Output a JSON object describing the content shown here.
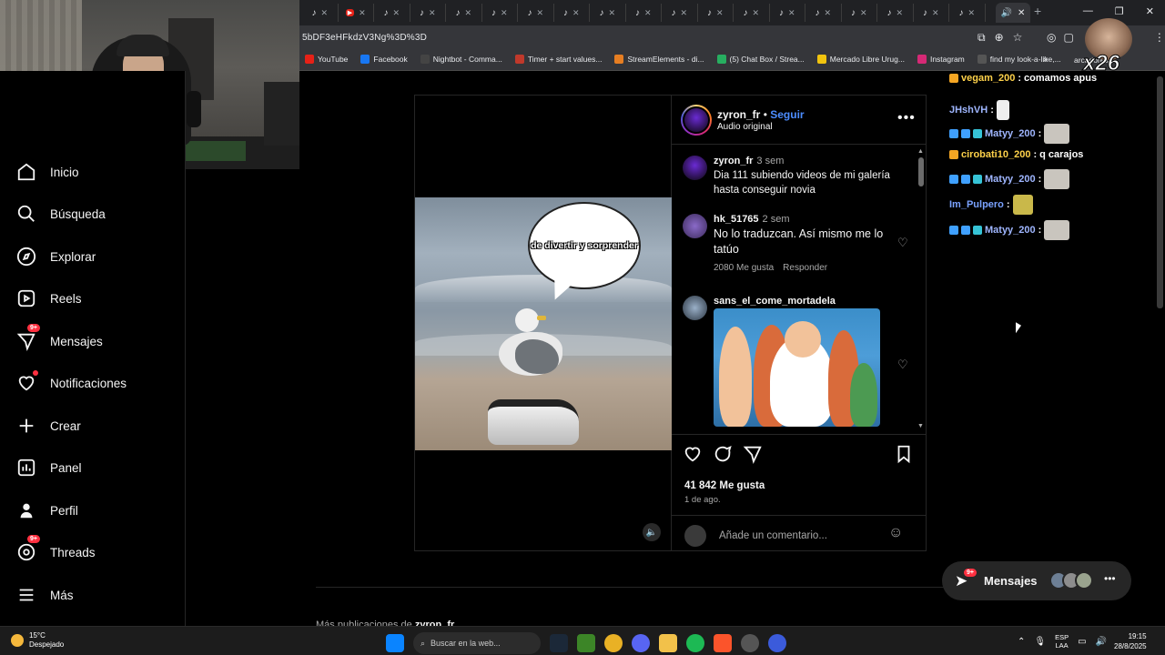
{
  "browser": {
    "url": "5bDF3eHFkdzV3Ng%3D%3D",
    "active_tab_icon": "speaker-icon",
    "tab_count_visible": 19,
    "bookmarks": [
      {
        "label": "YouTube",
        "color": "#e62117"
      },
      {
        "label": "Facebook",
        "color": "#1877f2"
      },
      {
        "label": "Nightbot - Comma...",
        "color": "#444444"
      },
      {
        "label": "Timer + start values...",
        "color": "#c0392b"
      },
      {
        "label": "StreamElements - di...",
        "color": "#e67e22"
      },
      {
        "label": "(5) Chat Box / Strea...",
        "color": "#27ae60"
      },
      {
        "label": "Mercado Libre Urug...",
        "color": "#f1c40f"
      },
      {
        "label": "Instagram",
        "color": "#d62976"
      },
      {
        "label": "find my look-a-like,...",
        "color": "#555555"
      }
    ],
    "bookmarks_more": "»",
    "bookmarks_folder": "arcadores"
  },
  "overlay": {
    "count_text": "x26"
  },
  "sidebar": {
    "items": [
      {
        "label": "Inicio",
        "icon": "home-icon"
      },
      {
        "label": "Búsqueda",
        "icon": "search-icon"
      },
      {
        "label": "Explorar",
        "icon": "compass-icon"
      },
      {
        "label": "Reels",
        "icon": "reels-icon"
      },
      {
        "label": "Mensajes",
        "icon": "messenger-icon",
        "badge": "9+"
      },
      {
        "label": "Notificaciones",
        "icon": "heart-icon"
      },
      {
        "label": "Crear",
        "icon": "plus-icon"
      },
      {
        "label": "Panel",
        "icon": "chart-icon"
      },
      {
        "label": "Perfil",
        "icon": "profile-icon"
      },
      {
        "label": "Threads",
        "icon": "threads-icon",
        "badge": "9+"
      },
      {
        "label": "Más",
        "icon": "menu-icon"
      }
    ]
  },
  "post": {
    "username": "zyron_fr",
    "separator": "•",
    "follow_label": "Seguir",
    "audio_label": "Audio original",
    "video_caption": "de divertir y sorprender",
    "caption": {
      "username": "zyron_fr",
      "time": "3 sem",
      "text": "Dia 111 subiendo videos de mi galería hasta conseguir novia"
    },
    "comments": [
      {
        "username": "hk_51765",
        "time": "2 sem",
        "text": "No lo traduzcan. Así mismo me lo tatúo",
        "likes": "2080 Me gusta",
        "reply": "Responder"
      },
      {
        "username": "sans_el_come_mortadela",
        "time": "",
        "text": ""
      }
    ],
    "likes": "41 842 Me gusta",
    "date": "1 de ago.",
    "add_comment_placeholder": "Añade un comentario...",
    "more_from_prefix": "Más publicaciones de",
    "more_from_user": "zyron_fr"
  },
  "chat": {
    "lines": [
      {
        "user": "vegam_200",
        "msg": "comamos apus",
        "color": "#ffd24a"
      },
      {
        "user": "JHshVH",
        "msg": "",
        "color": "#9fb6ff"
      },
      {
        "user": "Matyy_200",
        "msg": "",
        "color": "#9fb6ff"
      },
      {
        "user": "cirobati10_200",
        "msg": "q carajos",
        "color": "#ffd24a"
      },
      {
        "user": "Matyy_200",
        "msg": "",
        "color": "#9fb6ff"
      },
      {
        "user": "Im_Pulpero",
        "msg": "",
        "color": "#7aa2ff"
      },
      {
        "user": "Matyy_200",
        "msg": "",
        "color": "#9fb6ff"
      }
    ]
  },
  "messages_pill": {
    "label": "Mensajes",
    "badge": "9+"
  },
  "taskbar": {
    "temp": "15°C",
    "weather": "Despejado",
    "search_placeholder": "Buscar en la web...",
    "lang_line1": "ESP",
    "lang_line2": "LAA",
    "time": "19:15",
    "date": "28/8/2025"
  },
  "colors": {
    "follow_blue": "#4c8dff",
    "badge_red": "#ff3040",
    "muted_text": "#a8a8a8"
  }
}
